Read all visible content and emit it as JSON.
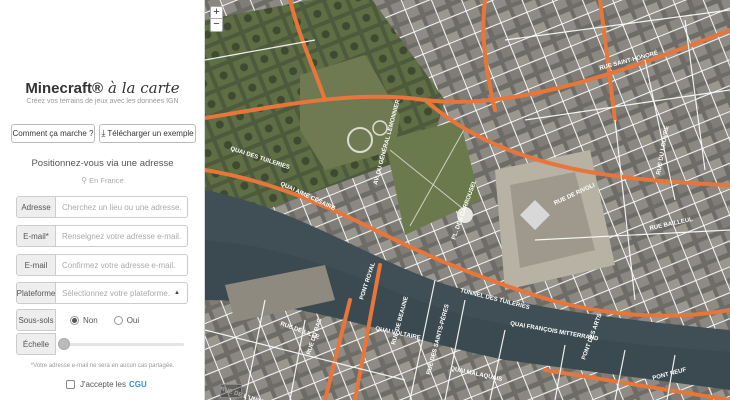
{
  "app": {
    "brand": "Minecraft®",
    "brand_suffix": "à la carte",
    "subtitle": "Créez vos terrains de jeux avec les données IGN"
  },
  "actions": {
    "howto_label": "Comment ça marche ?",
    "download_label": "Télécharger un exemple",
    "download_icon": "download-icon"
  },
  "locate": {
    "title": "Positionnez-vous via une adresse",
    "subtitle": "En France",
    "subtitle_icon": "map-pin-icon"
  },
  "form": {
    "address": {
      "label": "Adresse",
      "placeholder": "Cherchez un lieu ou une adresse."
    },
    "email": {
      "label": "E-mail*",
      "placeholder": "Renseignez votre adresse e-mail."
    },
    "email_confirm": {
      "label": "E-mail",
      "placeholder": "Confirmez votre adresse e-mail."
    },
    "platform": {
      "label": "Plateforme",
      "placeholder": "Sélectionnez votre plateforme.",
      "caret_icon": "caret-down-icon"
    },
    "basements": {
      "label": "Sous-sols",
      "options": [
        "Non",
        "Oui"
      ],
      "selected": "Non"
    },
    "scale": {
      "label": "Échelle",
      "value_fraction": 0.0
    },
    "footnote": "*Votre adresse e-mail ne sera en aucun cas partagée.",
    "terms": {
      "label": "J'accepte les",
      "link": "CGU",
      "checked": false
    }
  },
  "map": {
    "zoom_in": "+",
    "zoom_out": "−",
    "streets": [
      "RUE DE RIVOLI",
      "AV. DU GÉNÉRAL LEMONNIER",
      "QUAI DES TUILERIES",
      "QUAI AIMÉ CÉSAIRE",
      "PONT ROYAL",
      "QUAI FRANÇOIS MITTERRAND",
      "TUNNEL DES TUILERIES",
      "PONT DES ARTS",
      "QUAI VOLTAIRE",
      "QUAI MALAQUAIS",
      "RUE DE LILLE",
      "RUE DE BEAUNE",
      "RUE DU BAC",
      "RUE DE L'UNIVERSITÉ",
      "RUE DES SAINTS-PÈRES",
      "RUE DU LOUVRE",
      "RUE BAILLEUL",
      "PL. DES CARROUSEL",
      "RUE SAINT-HONORÉ",
      "PONT NEUF"
    ]
  },
  "colors": {
    "accent": "#3a8fd6",
    "road": "#e8763a",
    "river": "#3f4f55"
  }
}
